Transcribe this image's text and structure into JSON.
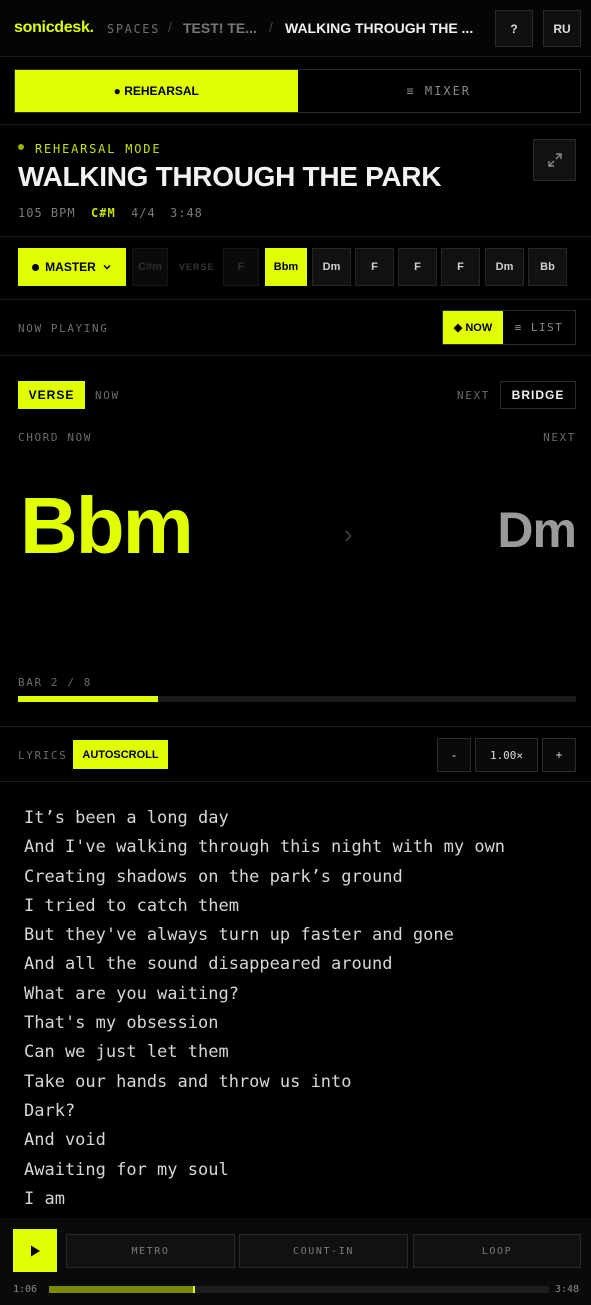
{
  "header": {
    "brand": "sonicdesk.",
    "breadcrumb_root": "SPACES",
    "breadcrumb_space": "TEST! TE...",
    "breadcrumb_song": "WALKING THROUGH THE ...",
    "help_label": "?",
    "lang_label": "RU"
  },
  "mode_tabs": [
    {
      "label": "● REHEARSAL",
      "active": true
    },
    {
      "label": "≡ MIXER",
      "active": false
    }
  ],
  "song": {
    "mode_label": "REHEARSAL MODE",
    "title": "WALKING THROUGH THE PARK",
    "bpm": "105 BPM",
    "key": "C#M",
    "time_signature": "4/4",
    "duration": "3:48"
  },
  "chord_bar": {
    "master_label": "MASTER",
    "faded_chord_1": "C#m",
    "section_label": "VERSE",
    "faded_chord_2": "F",
    "chords": [
      "Bbm",
      "Dm",
      "F",
      "F",
      "F",
      "Dm",
      "Bb"
    ],
    "active_index": 0
  },
  "now_playing": {
    "label": "NOW PLAYING",
    "toggle_now": "◆ NOW",
    "toggle_list": "≡ LIST"
  },
  "sections": {
    "current": "VERSE",
    "current_tag": "NOW",
    "next_tag": "NEXT",
    "next": "BRIDGE"
  },
  "chords": {
    "now_label": "CHORD NOW",
    "next_label": "NEXT",
    "now": "Bbm",
    "next": "Dm",
    "arrow": "›"
  },
  "bar": {
    "label": "BAR 2 / 8",
    "progress": 0.25
  },
  "lyrics_controls": {
    "label": "LYRICS",
    "autoscroll": "AUTOSCROLL",
    "minus": "-",
    "speed": "1.00×",
    "plus": "+"
  },
  "lyrics": [
    "It’s been a long day",
    "And I've walking through this night with my own",
    "Creating shadows on the park’s ground",
    "I tried to catch them",
    "But they've always turn up faster and gone",
    "And all the sound disappeared around",
    "What are you waiting?",
    "That's my obsession",
    "Can we just let them",
    "Take our hands and throw us into",
    "Dark?",
    "And void",
    "Awaiting for my soul",
    "I am"
  ],
  "transport": {
    "metro": "METRO",
    "count_in": "COUNT-IN",
    "loop": "LOOP",
    "elapsed": "1:06",
    "total": "3:48",
    "progress": 0.29
  },
  "colors": {
    "accent": "#e0ff00",
    "background": "#000000"
  }
}
